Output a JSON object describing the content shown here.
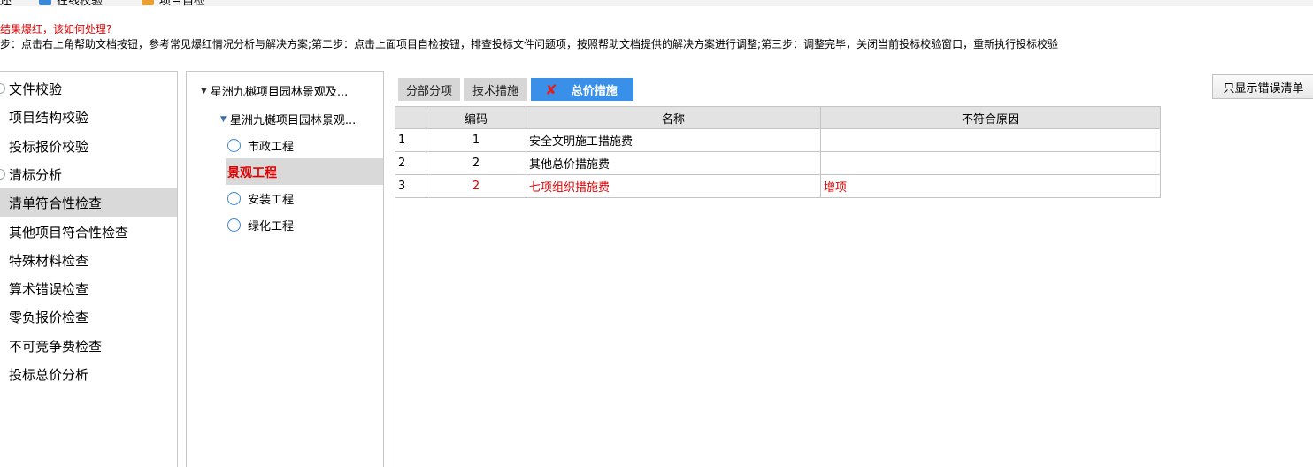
{
  "toolbar": {
    "items": [
      "还",
      "在线校验",
      "项目自检"
    ]
  },
  "hint": {
    "title": "结果爆红，该如何处理?",
    "steps": "步：点击右上角帮助文档按钮，参考常见爆红情况分析与解决方案;第二步：点击上面项目自检按钮，排查投标文件问题项，按照帮助文档提供的解决方案进行调整;第三步：调整完毕，关闭当前投标校验窗口，重新执行投标校验"
  },
  "nav": {
    "items": [
      {
        "label": "文件校验",
        "active": false
      },
      {
        "label": "项目结构校验",
        "active": false
      },
      {
        "label": "投标报价校验",
        "active": false
      },
      {
        "label": "清标分析",
        "active": false
      },
      {
        "label": "清单符合性检查",
        "active": true
      },
      {
        "label": "其他项目符合性检查",
        "active": false
      },
      {
        "label": "特殊材料检查",
        "active": false
      },
      {
        "label": "算术错误检查",
        "active": false
      },
      {
        "label": "零负报价检查",
        "active": false
      },
      {
        "label": "不可竞争费检查",
        "active": false
      },
      {
        "label": "投标总价分析",
        "active": false
      }
    ]
  },
  "tree": {
    "root": "星洲九樾项目园林景观及...",
    "child": "星洲九樾项目园林景观...",
    "leaves": [
      "市政工程",
      "景观工程",
      "安装工程",
      "绿化工程"
    ],
    "selected": "景观工程",
    "selected_color": "#e00000"
  },
  "tabs": [
    {
      "label": "分部分项",
      "active": false
    },
    {
      "label": "技术措施",
      "active": false
    },
    {
      "label": "总价措施",
      "active": true
    }
  ],
  "error_only_button": "只显示错误清单",
  "table": {
    "headers": [
      "",
      "编码",
      "名称",
      "不符合原因"
    ],
    "rows": [
      {
        "num": "1",
        "code": "1",
        "name": "安全文明施工措施费",
        "reason": "",
        "error": false
      },
      {
        "num": "2",
        "code": "2",
        "name": "其他总价措施费",
        "reason": "",
        "error": false
      },
      {
        "num": "3",
        "code": "2",
        "name": "七项组织措施费",
        "reason": "增项",
        "error": true
      }
    ]
  },
  "colors": {
    "accent": "#3a90e8",
    "error": "#e00000",
    "active_row": "#d9d9d9"
  }
}
